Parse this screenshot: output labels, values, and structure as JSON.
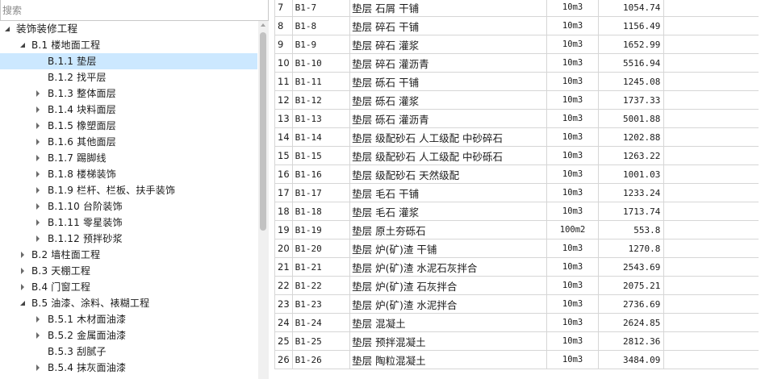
{
  "search": {
    "placeholder": "搜索"
  },
  "tree": [
    {
      "label": "装饰装修工程",
      "level": 0,
      "expander": "open",
      "selected": false
    },
    {
      "label": "B.1 楼地面工程",
      "level": 1,
      "expander": "open",
      "selected": false
    },
    {
      "label": "B.1.1 垫层",
      "level": 2,
      "expander": "none",
      "selected": true
    },
    {
      "label": "B.1.2 找平层",
      "level": 2,
      "expander": "none",
      "selected": false
    },
    {
      "label": "B.1.3 整体面层",
      "level": 2,
      "expander": "closed",
      "selected": false
    },
    {
      "label": "B.1.4 块料面层",
      "level": 2,
      "expander": "closed",
      "selected": false
    },
    {
      "label": "B.1.5 橡塑面层",
      "level": 2,
      "expander": "closed",
      "selected": false
    },
    {
      "label": "B.1.6 其他面层",
      "level": 2,
      "expander": "closed",
      "selected": false
    },
    {
      "label": "B.1.7 踢脚线",
      "level": 2,
      "expander": "closed",
      "selected": false
    },
    {
      "label": "B.1.8 楼梯装饰",
      "level": 2,
      "expander": "closed",
      "selected": false
    },
    {
      "label": "B.1.9 栏杆、栏板、扶手装饰",
      "level": 2,
      "expander": "closed",
      "selected": false
    },
    {
      "label": "B.1.10 台阶装饰",
      "level": 2,
      "expander": "closed",
      "selected": false
    },
    {
      "label": "B.1.11 零星装饰",
      "level": 2,
      "expander": "closed",
      "selected": false
    },
    {
      "label": "B.1.12 预拌砂浆",
      "level": 2,
      "expander": "closed",
      "selected": false
    },
    {
      "label": "B.2 墙柱面工程",
      "level": 1,
      "expander": "closed",
      "selected": false
    },
    {
      "label": "B.3 天棚工程",
      "level": 1,
      "expander": "closed",
      "selected": false
    },
    {
      "label": "B.4 门窗工程",
      "level": 1,
      "expander": "closed",
      "selected": false
    },
    {
      "label": "B.5 油漆、涂料、裱糊工程",
      "level": 1,
      "expander": "open",
      "selected": false
    },
    {
      "label": "B.5.1 木材面油漆",
      "level": 2,
      "expander": "closed",
      "selected": false
    },
    {
      "label": "B.5.2 金属面油漆",
      "level": 2,
      "expander": "closed",
      "selected": false
    },
    {
      "label": "B.5.3 刮腻子",
      "level": 2,
      "expander": "none",
      "selected": false
    },
    {
      "label": "B.5.4 抹灰面油漆",
      "level": 2,
      "expander": "closed",
      "selected": false
    }
  ],
  "table": {
    "rows": [
      {
        "idx": "7",
        "code": "B1-7",
        "name": "垫层 石屑 干铺",
        "unit": "10m3",
        "price": "1054.74"
      },
      {
        "idx": "8",
        "code": "B1-8",
        "name": "垫层 碎石 干铺",
        "unit": "10m3",
        "price": "1156.49"
      },
      {
        "idx": "9",
        "code": "B1-9",
        "name": "垫层 碎石 灌浆",
        "unit": "10m3",
        "price": "1652.99"
      },
      {
        "idx": "10",
        "code": "B1-10",
        "name": "垫层 碎石 灌沥青",
        "unit": "10m3",
        "price": "5516.94"
      },
      {
        "idx": "11",
        "code": "B1-11",
        "name": "垫层 砾石 干铺",
        "unit": "10m3",
        "price": "1245.08"
      },
      {
        "idx": "12",
        "code": "B1-12",
        "name": "垫层 砾石 灌浆",
        "unit": "10m3",
        "price": "1737.33"
      },
      {
        "idx": "13",
        "code": "B1-13",
        "name": "垫层 砾石 灌沥青",
        "unit": "10m3",
        "price": "5001.88"
      },
      {
        "idx": "14",
        "code": "B1-14",
        "name": "垫层 级配砂石 人工级配 中砂碎石",
        "unit": "10m3",
        "price": "1202.88"
      },
      {
        "idx": "15",
        "code": "B1-15",
        "name": "垫层 级配砂石 人工级配 中砂砾石",
        "unit": "10m3",
        "price": "1263.22"
      },
      {
        "idx": "16",
        "code": "B1-16",
        "name": "垫层 级配砂石 天然级配",
        "unit": "10m3",
        "price": "1001.03"
      },
      {
        "idx": "17",
        "code": "B1-17",
        "name": "垫层 毛石 干铺",
        "unit": "10m3",
        "price": "1233.24"
      },
      {
        "idx": "18",
        "code": "B1-18",
        "name": "垫层 毛石 灌浆",
        "unit": "10m3",
        "price": "1713.74"
      },
      {
        "idx": "19",
        "code": "B1-19",
        "name": "垫层 原土夯砾石",
        "unit": "100m2",
        "price": "553.8"
      },
      {
        "idx": "20",
        "code": "B1-20",
        "name": "垫层 炉(矿)渣 干铺",
        "unit": "10m3",
        "price": "1270.8"
      },
      {
        "idx": "21",
        "code": "B1-21",
        "name": "垫层 炉(矿)渣 水泥石灰拌合",
        "unit": "10m3",
        "price": "2543.69"
      },
      {
        "idx": "22",
        "code": "B1-22",
        "name": "垫层 炉(矿)渣 石灰拌合",
        "unit": "10m3",
        "price": "2075.21"
      },
      {
        "idx": "23",
        "code": "B1-23",
        "name": "垫层 炉(矿)渣 水泥拌合",
        "unit": "10m3",
        "price": "2736.69"
      },
      {
        "idx": "24",
        "code": "B1-24",
        "name": "垫层 混凝土",
        "unit": "10m3",
        "price": "2624.85"
      },
      {
        "idx": "25",
        "code": "B1-25",
        "name": "垫层 预拌混凝土",
        "unit": "10m3",
        "price": "2812.36"
      },
      {
        "idx": "26",
        "code": "B1-26",
        "name": "垫层 陶粒混凝土",
        "unit": "10m3",
        "price": "3484.09"
      }
    ]
  },
  "colors": {
    "selection": "#cce8ff",
    "grid_line": "#d6d6d6",
    "scroll_thumb": "#c2c2c2"
  }
}
